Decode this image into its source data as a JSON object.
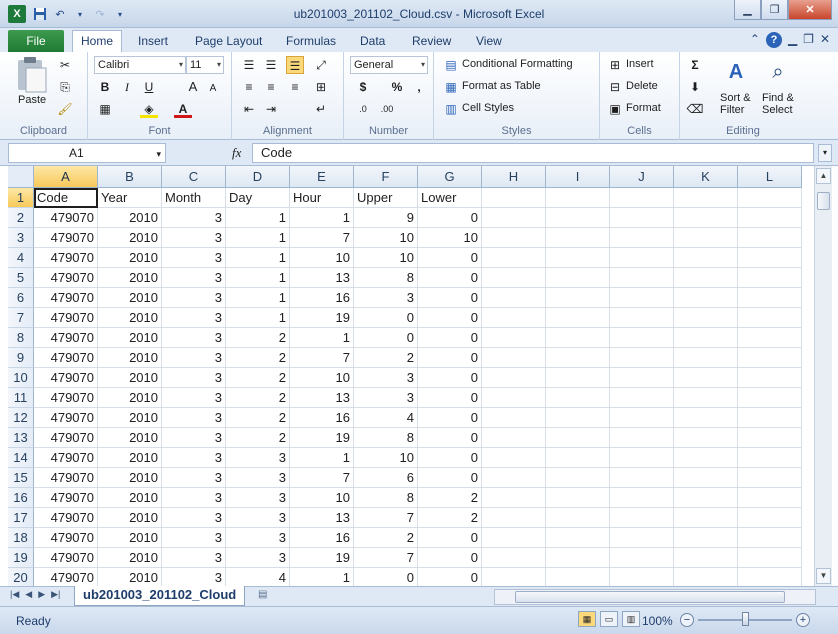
{
  "window": {
    "title": "ub201003_201102_Cloud.csv - Microsoft Excel",
    "app_icon_letter": "X"
  },
  "ribbon_tabs": [
    {
      "label": "File"
    },
    {
      "label": "Home"
    },
    {
      "label": "Insert"
    },
    {
      "label": "Page Layout"
    },
    {
      "label": "Formulas"
    },
    {
      "label": "Data"
    },
    {
      "label": "Review"
    },
    {
      "label": "View"
    }
  ],
  "ribbon": {
    "clipboard": {
      "paste": "Paste",
      "label": "Clipboard"
    },
    "font": {
      "name": "Calibri",
      "size": "11",
      "label": "Font"
    },
    "alignment": {
      "label": "Alignment"
    },
    "number": {
      "format": "General",
      "label": "Number"
    },
    "styles": {
      "conditional": "Conditional Formatting",
      "table": "Format as Table",
      "cell_styles": "Cell Styles",
      "label": "Styles"
    },
    "cells": {
      "insert": "Insert",
      "delete": "Delete",
      "format": "Format",
      "label": "Cells"
    },
    "editing": {
      "sort_1": "Sort &",
      "sort_2": "Filter",
      "find_1": "Find &",
      "find_2": "Select",
      "label": "Editing"
    }
  },
  "formula_bar": {
    "name_box": "A1",
    "fx": "fx",
    "value": "Code"
  },
  "columns": [
    "A",
    "B",
    "C",
    "D",
    "E",
    "F",
    "G",
    "H",
    "I",
    "J",
    "K",
    "L"
  ],
  "rows": [
    [
      "Code",
      "Year",
      "Month",
      "Day",
      "Hour",
      "Upper",
      "Lower"
    ],
    [
      "479070",
      "2010",
      "3",
      "1",
      "1",
      "9",
      "0"
    ],
    [
      "479070",
      "2010",
      "3",
      "1",
      "7",
      "10",
      "10"
    ],
    [
      "479070",
      "2010",
      "3",
      "1",
      "10",
      "10",
      "0"
    ],
    [
      "479070",
      "2010",
      "3",
      "1",
      "13",
      "8",
      "0"
    ],
    [
      "479070",
      "2010",
      "3",
      "1",
      "16",
      "3",
      "0"
    ],
    [
      "479070",
      "2010",
      "3",
      "1",
      "19",
      "0",
      "0"
    ],
    [
      "479070",
      "2010",
      "3",
      "2",
      "1",
      "0",
      "0"
    ],
    [
      "479070",
      "2010",
      "3",
      "2",
      "7",
      "2",
      "0"
    ],
    [
      "479070",
      "2010",
      "3",
      "2",
      "10",
      "3",
      "0"
    ],
    [
      "479070",
      "2010",
      "3",
      "2",
      "13",
      "3",
      "0"
    ],
    [
      "479070",
      "2010",
      "3",
      "2",
      "16",
      "4",
      "0"
    ],
    [
      "479070",
      "2010",
      "3",
      "2",
      "19",
      "8",
      "0"
    ],
    [
      "479070",
      "2010",
      "3",
      "3",
      "1",
      "10",
      "0"
    ],
    [
      "479070",
      "2010",
      "3",
      "3",
      "7",
      "6",
      "0"
    ],
    [
      "479070",
      "2010",
      "3",
      "3",
      "10",
      "8",
      "2"
    ],
    [
      "479070",
      "2010",
      "3",
      "3",
      "13",
      "7",
      "2"
    ],
    [
      "479070",
      "2010",
      "3",
      "3",
      "16",
      "2",
      "0"
    ],
    [
      "479070",
      "2010",
      "3",
      "3",
      "19",
      "7",
      "0"
    ],
    [
      "479070",
      "2010",
      "3",
      "4",
      "1",
      "0",
      "0"
    ]
  ],
  "sheet_tab": "ub201003_201102_Cloud",
  "status": {
    "text": "Ready",
    "zoom": "100%"
  }
}
